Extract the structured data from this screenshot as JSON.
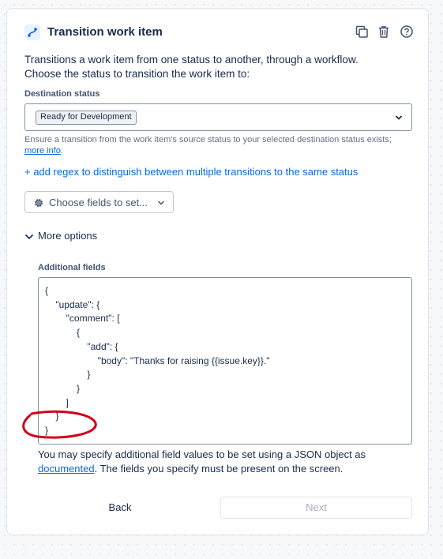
{
  "header": {
    "title": "Transition work item",
    "icons": [
      "transition-icon",
      "copy-icon",
      "trash-icon",
      "help-icon"
    ]
  },
  "description": {
    "line1": "Transitions a work item from one status to another, through a workflow.",
    "line2": "Choose the status to transition the work item to:"
  },
  "destination": {
    "label": "Destination status",
    "value": "Ready for Development",
    "hint_text": "Ensure a transition from the work item's source status to your selected destination status exists; ",
    "hint_link": "more info",
    "hint_end": "."
  },
  "regex_link": "+ add regex to distinguish between multiple transitions to the same status",
  "fields_button": "Choose fields to set...",
  "more_options": "More options",
  "additional_fields": {
    "label": "Additional fields",
    "json": "{\n    \"update\": {\n        \"comment\": [\n            {\n                \"add\": {\n                    \"body\": \"Thanks for raising {{issue.key}}.\"\n                }\n            }\n        ]\n    }\n}"
  },
  "help": {
    "text1": "You may specify additional field values to be set using a JSON object as ",
    "link": "documented",
    "text2": ". The fields you specify must be present on the screen."
  },
  "footer": {
    "back": "Back",
    "next": "Next"
  },
  "colors": {
    "link": "#0c66e4",
    "annotation": "#d0021b"
  }
}
